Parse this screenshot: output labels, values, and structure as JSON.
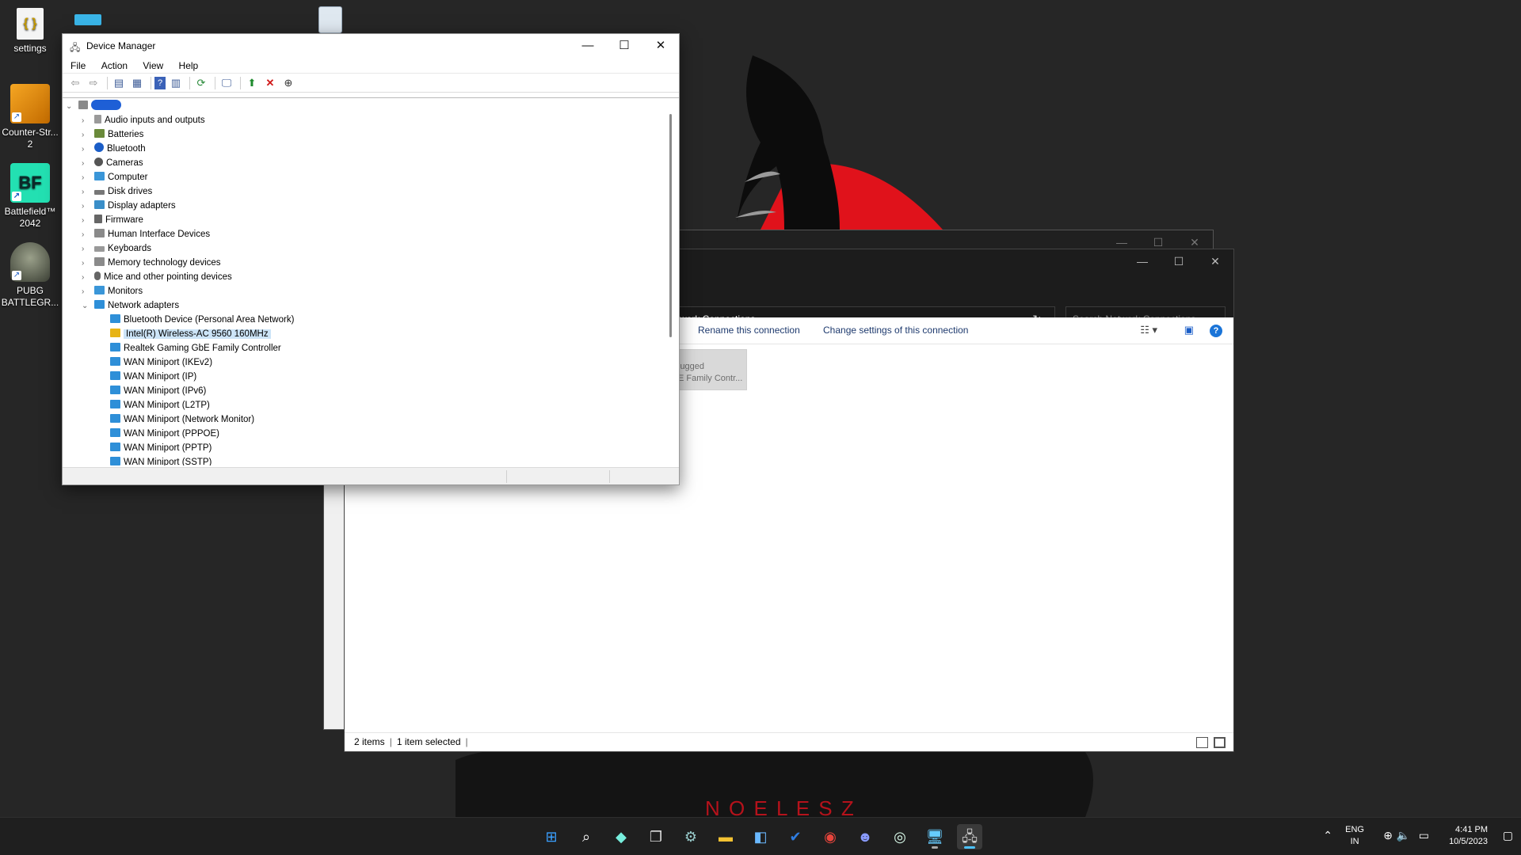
{
  "desktop": {
    "icons": [
      {
        "label": "settings",
        "icon": "json-file-icon"
      },
      {
        "label": "Counter-Str... 2",
        "icon": "counter-strike-icon"
      },
      {
        "label": "Battlefield™ 2042",
        "icon": "battlefield-icon"
      },
      {
        "label": "PUBG BATTLEGR...",
        "icon": "pubg-icon"
      }
    ],
    "wallpaper_text": "N O E L E S Z"
  },
  "device_manager": {
    "title": "Device Manager",
    "menu": [
      "File",
      "Action",
      "View",
      "Help"
    ],
    "toolbar": [
      "back-icon",
      "forward-icon",
      "show-hide-console-tree-icon",
      "properties-icon",
      "help-icon",
      "view-icon",
      "scan-hardware-icon",
      "display-icon",
      "update-driver-icon",
      "uninstall-device-icon",
      "download-icon"
    ],
    "tree": {
      "categories": [
        "Audio inputs and outputs",
        "Batteries",
        "Bluetooth",
        "Cameras",
        "Computer",
        "Disk drives",
        "Display adapters",
        "Firmware",
        "Human Interface Devices",
        "Keyboards",
        "Memory technology devices",
        "Mice and other pointing devices",
        "Monitors",
        "Network adapters"
      ],
      "network_adapters": [
        "Bluetooth Device (Personal Area Network)",
        "Intel(R) Wireless-AC 9560 160MHz",
        "Realtek Gaming GbE Family Controller",
        "WAN Miniport (IKEv2)",
        "WAN Miniport (IP)",
        "WAN Miniport (IPv6)",
        "WAN Miniport (L2TP)",
        "WAN Miniport (Network Monitor)",
        "WAN Miniport (PPPOE)",
        "WAN Miniport (PPTP)",
        "WAN Miniport (SSTP)"
      ],
      "selected": "Intel(R) Wireless-AC 9560 160MHz"
    }
  },
  "network_connections": {
    "address": "etwork Connections",
    "search_placeholder": "Search Network Connections",
    "commands": [
      "Rename this connection",
      "Change settings of this connection"
    ],
    "item": {
      "line1": "lugged",
      "line2": "E Family Contr..."
    },
    "status": {
      "items": "2 items",
      "selected": "1 item selected"
    }
  },
  "taskbar": {
    "apps": [
      "start-icon",
      "search-icon",
      "copilot-icon",
      "task-view-icon",
      "settings-icon",
      "file-explorer-icon",
      "store-icon",
      "todo-icon",
      "chrome-icon",
      "discord-icon",
      "steam-icon",
      "remote-desktop-icon",
      "device-manager-icon"
    ],
    "language": {
      "line1": "ENG",
      "line2": "IN"
    },
    "clock": {
      "time": "4:41 PM",
      "date": "10/5/2023"
    }
  },
  "colors": {
    "selection": "#cce4f7",
    "accent": "#1a74d8",
    "wallpaper_red": "#e0121b"
  }
}
